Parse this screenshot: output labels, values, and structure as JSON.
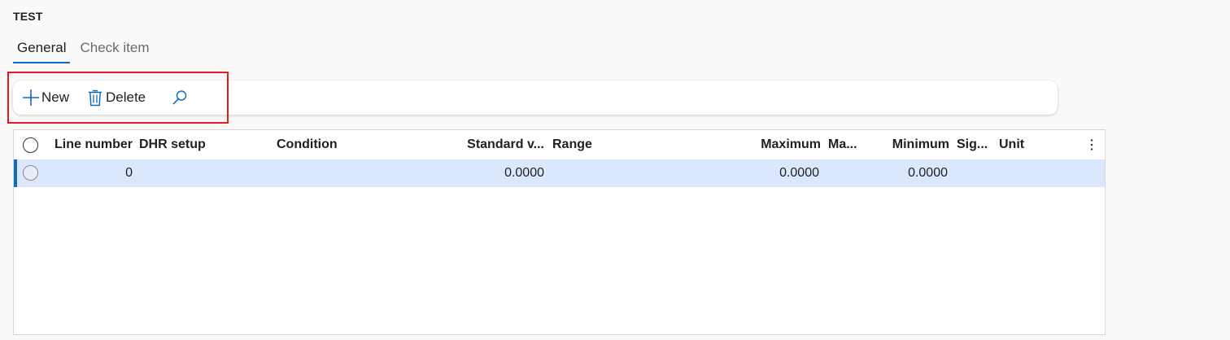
{
  "page": {
    "title": "TEST"
  },
  "tabs": [
    {
      "label": "General",
      "active": true
    },
    {
      "label": "Check item",
      "active": false
    }
  ],
  "toolbar": {
    "new_label": "New",
    "delete_label": "Delete",
    "new_icon": "plus-icon",
    "delete_icon": "trash-icon",
    "search_icon": "search-icon"
  },
  "grid": {
    "columns": [
      {
        "key": "line_number",
        "label": "Line number"
      },
      {
        "key": "dhr_setup",
        "label": "DHR setup"
      },
      {
        "key": "condition",
        "label": "Condition"
      },
      {
        "key": "standard_value",
        "label": "Standard v..."
      },
      {
        "key": "range",
        "label": "Range"
      },
      {
        "key": "maximum",
        "label": "Maximum"
      },
      {
        "key": "ma",
        "label": "Ma..."
      },
      {
        "key": "minimum",
        "label": "Minimum"
      },
      {
        "key": "sig",
        "label": "Sig..."
      },
      {
        "key": "unit",
        "label": "Unit"
      }
    ],
    "rows": [
      {
        "line_number": "0",
        "dhr_setup": "",
        "condition": "",
        "standard_value": "0.0000",
        "range": "",
        "maximum": "0.0000",
        "ma": "",
        "minimum": "0.0000",
        "sig": "",
        "unit": ""
      }
    ],
    "more_icon": "more-vertical-icon"
  },
  "colors": {
    "accent": "#0f6cbd",
    "selected_row": "#dbe7fc",
    "highlight_box": "#e01b24",
    "background": "#faf9f8"
  }
}
